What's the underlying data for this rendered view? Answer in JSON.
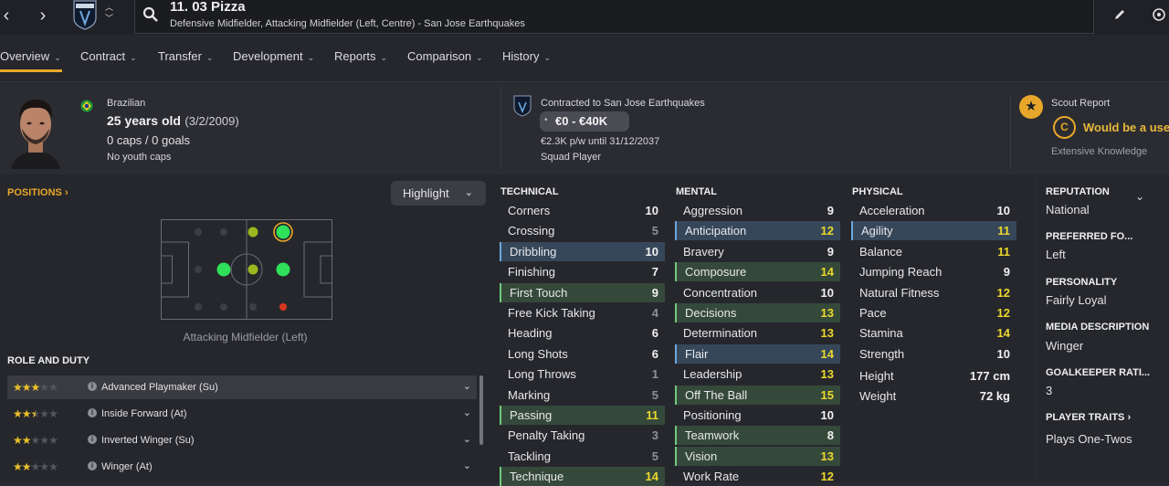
{
  "topbar": {
    "player_name": "11. 03 Pizza",
    "player_sub": "Defensive Midfielder, Attacking Midfielder (Left, Centre) - San Jose Earthquakes",
    "club_badge_text": "QUAKES"
  },
  "tabs": [
    {
      "label": "Overview"
    },
    {
      "label": "Contract"
    },
    {
      "label": "Transfer"
    },
    {
      "label": "Development"
    },
    {
      "label": "Reports"
    },
    {
      "label": "Comparison"
    },
    {
      "label": "History"
    }
  ],
  "header": {
    "nationality": "Brazilian",
    "age": "25 years old",
    "dob": "(3/2/2009)",
    "caps_goals": "0 caps / 0 goals",
    "youth_caps": "No youth caps",
    "contract_club": "Contracted to San Jose Earthquakes",
    "value": "€0 - €40K",
    "wage": "€2.3K p/w until 31/12/2037",
    "squad_status": "Squad Player",
    "scout_title": "Scout Report",
    "scout_grade": "C",
    "scout_text": "Would be a usef",
    "scout_knowledge": "Extensive Knowledge"
  },
  "positions": {
    "title": "POSITIONS",
    "highlight_label": "Highlight",
    "caption": "Attacking Midfielder (Left)"
  },
  "roles": {
    "title": "ROLE AND DUTY",
    "items": [
      {
        "name": "Advanced Playmaker (Su)",
        "stars": 3
      },
      {
        "name": "Inside Forward (At)",
        "stars": 2.5
      },
      {
        "name": "Inverted Winger (Su)",
        "stars": 2
      },
      {
        "name": "Winger (At)",
        "stars": 2
      }
    ]
  },
  "technical": {
    "title": "TECHNICAL",
    "rows": [
      {
        "name": "Corners",
        "value": "10",
        "hl": "",
        "vc": "white"
      },
      {
        "name": "Crossing",
        "value": "5",
        "hl": "",
        "vc": "grey"
      },
      {
        "name": "Dribbling",
        "value": "10",
        "hl": "blue",
        "vc": "white"
      },
      {
        "name": "Finishing",
        "value": "7",
        "hl": "",
        "vc": "white"
      },
      {
        "name": "First Touch",
        "value": "9",
        "hl": "green",
        "vc": "white"
      },
      {
        "name": "Free Kick Taking",
        "value": "4",
        "hl": "",
        "vc": "grey"
      },
      {
        "name": "Heading",
        "value": "6",
        "hl": "",
        "vc": "white"
      },
      {
        "name": "Long Shots",
        "value": "6",
        "hl": "",
        "vc": "white"
      },
      {
        "name": "Long Throws",
        "value": "1",
        "hl": "",
        "vc": "grey"
      },
      {
        "name": "Marking",
        "value": "5",
        "hl": "",
        "vc": "grey"
      },
      {
        "name": "Passing",
        "value": "11",
        "hl": "green",
        "vc": "yellow"
      },
      {
        "name": "Penalty Taking",
        "value": "3",
        "hl": "",
        "vc": "grey"
      },
      {
        "name": "Tackling",
        "value": "5",
        "hl": "",
        "vc": "grey"
      },
      {
        "name": "Technique",
        "value": "14",
        "hl": "green",
        "vc": "yellow"
      }
    ]
  },
  "mental": {
    "title": "MENTAL",
    "rows": [
      {
        "name": "Aggression",
        "value": "9",
        "hl": "",
        "vc": "white"
      },
      {
        "name": "Anticipation",
        "value": "12",
        "hl": "blue",
        "vc": "yellow"
      },
      {
        "name": "Bravery",
        "value": "9",
        "hl": "",
        "vc": "white"
      },
      {
        "name": "Composure",
        "value": "14",
        "hl": "green",
        "vc": "yellow"
      },
      {
        "name": "Concentration",
        "value": "10",
        "hl": "",
        "vc": "white"
      },
      {
        "name": "Decisions",
        "value": "13",
        "hl": "green",
        "vc": "yellow"
      },
      {
        "name": "Determination",
        "value": "13",
        "hl": "",
        "vc": "yellow"
      },
      {
        "name": "Flair",
        "value": "14",
        "hl": "blue",
        "vc": "yellow"
      },
      {
        "name": "Leadership",
        "value": "13",
        "hl": "",
        "vc": "yellow"
      },
      {
        "name": "Off The Ball",
        "value": "15",
        "hl": "green",
        "vc": "yellow"
      },
      {
        "name": "Positioning",
        "value": "10",
        "hl": "",
        "vc": "white"
      },
      {
        "name": "Teamwork",
        "value": "8",
        "hl": "green",
        "vc": "white"
      },
      {
        "name": "Vision",
        "value": "13",
        "hl": "green",
        "vc": "yellow"
      },
      {
        "name": "Work Rate",
        "value": "12",
        "hl": "",
        "vc": "yellow"
      }
    ]
  },
  "physical": {
    "title": "PHYSICAL",
    "rows": [
      {
        "name": "Acceleration",
        "value": "10",
        "hl": "",
        "vc": "white"
      },
      {
        "name": "Agility",
        "value": "11",
        "hl": "blue",
        "vc": "yellow"
      },
      {
        "name": "Balance",
        "value": "11",
        "hl": "",
        "vc": "yellow"
      },
      {
        "name": "Jumping Reach",
        "value": "9",
        "hl": "",
        "vc": "white"
      },
      {
        "name": "Natural Fitness",
        "value": "12",
        "hl": "",
        "vc": "yellow"
      },
      {
        "name": "Pace",
        "value": "12",
        "hl": "",
        "vc": "yellow"
      },
      {
        "name": "Stamina",
        "value": "14",
        "hl": "",
        "vc": "yellow"
      },
      {
        "name": "Strength",
        "value": "10",
        "hl": "",
        "vc": "white"
      }
    ],
    "height_label": "Height",
    "height_value": "177 cm",
    "weight_label": "Weight",
    "weight_value": "72 kg"
  },
  "info": {
    "reputation_title": "REPUTATION",
    "reputation_value": "National",
    "foot_title": "PREFERRED FO...",
    "foot_value": "Left",
    "personality_title": "PERSONALITY",
    "personality_value": "Fairly Loyal",
    "media_title": "MEDIA DESCRIPTION",
    "media_value": "Winger",
    "gk_title": "GOALKEEPER RATI...",
    "gk_value": "3",
    "traits_title": "PLAYER TRAITS",
    "traits_value": "Plays One-Twos"
  },
  "colors": {
    "accent": "#e8a72a",
    "good": "#ecd82c",
    "natural": "#2ee05a"
  }
}
